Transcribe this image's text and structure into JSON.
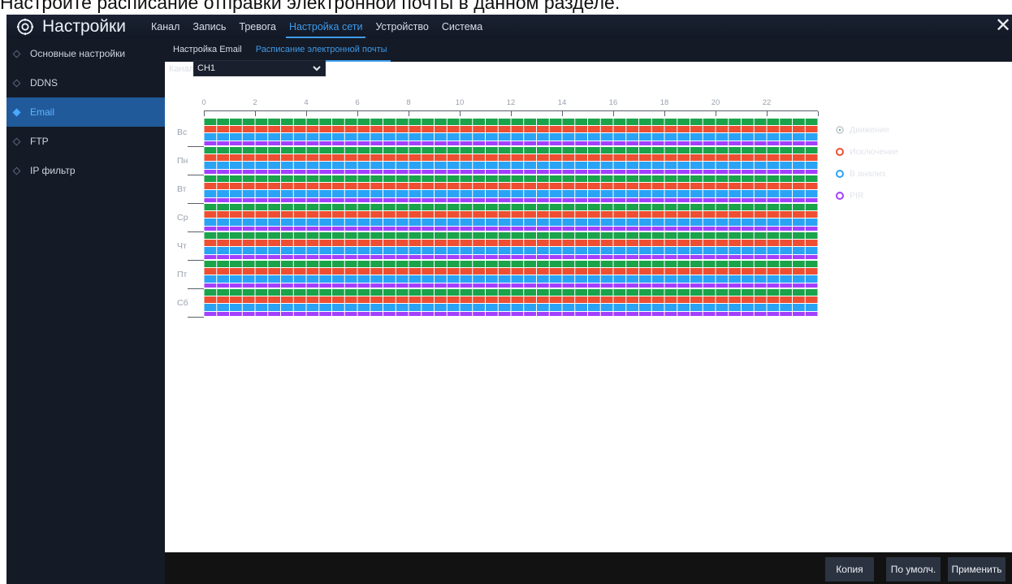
{
  "caption": "Настройте расписание отправки электронной почты в данном разделе.",
  "header": {
    "title": "Настройки",
    "tabs": [
      {
        "label": "Канал",
        "active": false
      },
      {
        "label": "Запись",
        "active": false
      },
      {
        "label": "Тревога",
        "active": false
      },
      {
        "label": "Настройка сети",
        "active": true
      },
      {
        "label": "Устройство",
        "active": false
      },
      {
        "label": "Система",
        "active": false
      }
    ],
    "close_icon": "close-icon"
  },
  "sidebar": {
    "items": [
      {
        "label": "Основные настройки",
        "active": false
      },
      {
        "label": "DDNS",
        "active": false
      },
      {
        "label": "Email",
        "active": true
      },
      {
        "label": "FTP",
        "active": false
      },
      {
        "label": "IP фильтр",
        "active": false
      }
    ]
  },
  "subtabs": [
    {
      "label": "Настройка Email",
      "active": false
    },
    {
      "label": "Расписание электронной почты",
      "active": true
    }
  ],
  "channel": {
    "label": "Канал",
    "value": "CH1"
  },
  "schedule": {
    "hour_labels": [
      "0",
      "2",
      "4",
      "6",
      "8",
      "10",
      "12",
      "14",
      "16",
      "18",
      "20",
      "22"
    ],
    "days": [
      "Вс",
      "Пн",
      "Вт",
      "Ср",
      "Чт",
      "Пт",
      "Сб"
    ],
    "slots_per_day": 48,
    "all_enabled": true
  },
  "legend": [
    {
      "label": "Движение",
      "color": "#1aa34a",
      "selected": true
    },
    {
      "label": "Исключение",
      "color": "#ee4f33",
      "selected": false
    },
    {
      "label": "В анализ",
      "color": "#2aa3f5",
      "selected": false
    },
    {
      "label": "PIR",
      "color": "#a340ff",
      "selected": false
    }
  ],
  "buttons": {
    "copy": "Копия",
    "default": "По умолч.",
    "apply": "Применить"
  },
  "colors": {
    "accent": "#3f9bea",
    "sidebar_active": "#215a9b",
    "motion": "#1aa34a",
    "exception": "#ee4f33",
    "analysis": "#2aa3f5",
    "pir": "#a340ff"
  }
}
